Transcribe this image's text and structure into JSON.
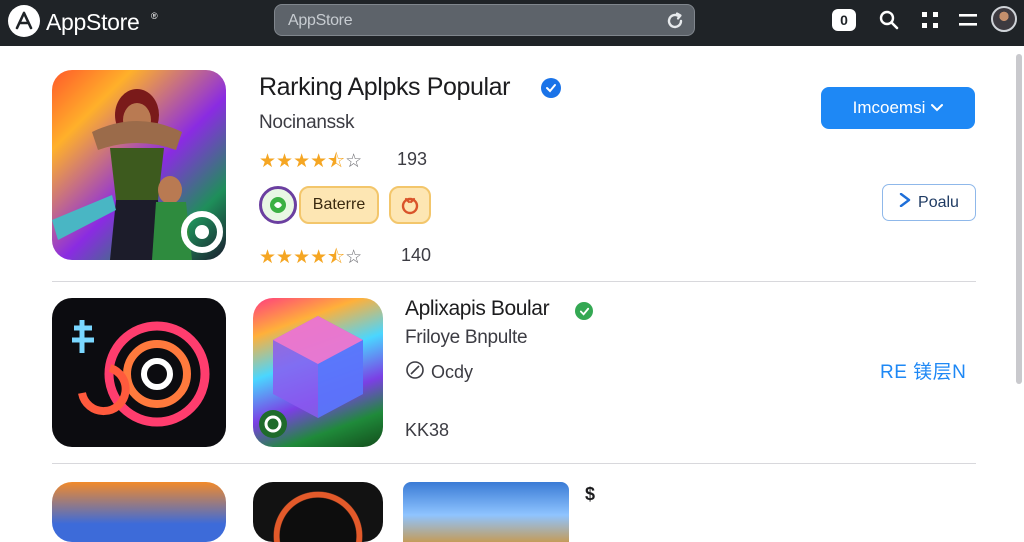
{
  "topbar": {
    "brand": "AppStore",
    "brand_mark": "®",
    "search_value": "AppStore",
    "notification_count": "0"
  },
  "apps": [
    {
      "title": "Rarking Aplpks Popular",
      "subtitle": "Nocinanssk",
      "rating_1": {
        "filled": 4.5,
        "of": 5,
        "count": "193"
      },
      "chip_label": "Baterre",
      "rating_2": {
        "filled": 4.5,
        "of": 5,
        "count": "140"
      },
      "primary_button": "Imcoemsi",
      "secondary_button": "Poalu"
    },
    {
      "title": "Aplixapis Boular",
      "subtitle": "Friloye Bnpulte",
      "meta_label": "Ocdy",
      "size_label": "KK38",
      "link_button": "RE 镁层N"
    }
  ],
  "row3_mark": "$",
  "colors": {
    "accent": "#1e88f5",
    "topbar": "#1f2327",
    "star": "#f5a623",
    "verified_blue": "#1a73e8",
    "verified_green": "#34a853"
  },
  "icons": [
    "app-store-logo-icon",
    "reload-icon",
    "search-icon",
    "grid-icon",
    "menu-icon",
    "verified-icon",
    "chevron-down-icon",
    "play-icon",
    "clock-icon"
  ]
}
